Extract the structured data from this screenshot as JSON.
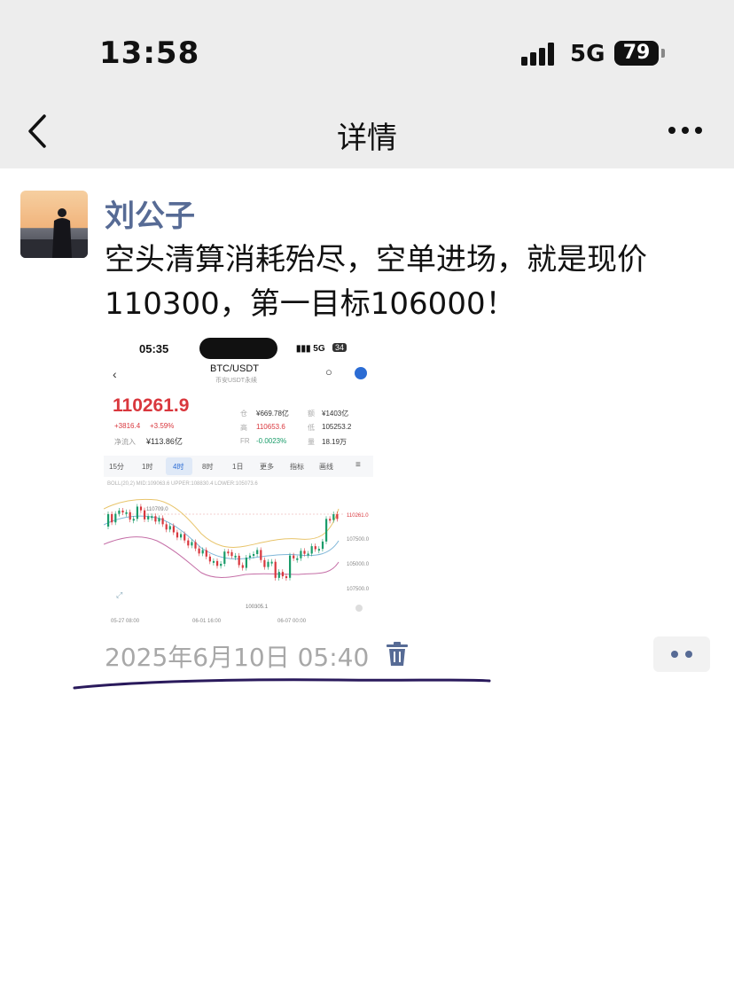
{
  "status": {
    "time": "13:58",
    "network": "5G",
    "battery": "79"
  },
  "nav": {
    "title": "详情"
  },
  "post": {
    "author": "刘公子",
    "text": "空头清算消耗殆尽，空单进场，就是现价110300，第一目标106000！",
    "timestamp": "2025年6月10日 05:40"
  },
  "embedded_screenshot": {
    "time": "05:35",
    "network": "5G",
    "battery": "34",
    "pair": "BTC/USDT",
    "subtitle": "币安USDT永续",
    "price": "110261.9",
    "change": "+3816.4",
    "change_pct": "+3.59%",
    "net_inflow_label": "净流入",
    "net_inflow": "¥113.86亿",
    "stats": [
      {
        "label": "仓",
        "value": "¥669.78亿"
      },
      {
        "label": "额",
        "value": "¥1403亿"
      },
      {
        "label": "高",
        "value": "110653.6"
      },
      {
        "label": "低",
        "value": "105253.2"
      },
      {
        "label": "FR",
        "value": "-0.0023%"
      },
      {
        "label": "量",
        "value": "18.19万"
      }
    ],
    "tabs": [
      "15分",
      "1时",
      "4时",
      "8时",
      "1日",
      "更多",
      "指标",
      "画线"
    ],
    "active_tab": "4时",
    "indicator_line": "BOLL(20,2) MID:109063.6 UPPER:108830.4 LOWER:105073.6",
    "price_labels": [
      "110261.0",
      "107500.0",
      "105000.0",
      "107500.0"
    ],
    "high_label": "110709.0",
    "low_label": "100305.1",
    "date_labels": [
      "05-27 08:00",
      "06-01 16:00",
      "06-07 00:00"
    ],
    "colors": {
      "up": "#1a9c6a",
      "down": "#d9373d",
      "upper": "#e8c46a",
      "mid": "#7fb6d8",
      "lower": "#c56fa7"
    }
  }
}
